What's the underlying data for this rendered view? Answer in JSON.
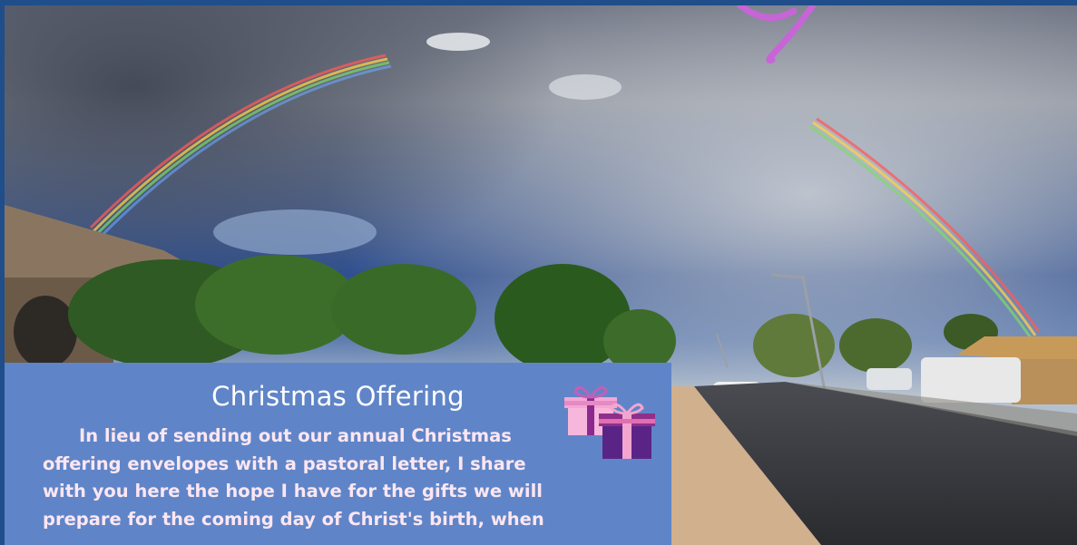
{
  "offering": {
    "title": "Christmas Offering",
    "body_lines": [
      "In lieu of sending out our annual Christmas",
      "offering envelopes with a pastoral letter, I share",
      "with you here the hope I have for the gifts we will",
      "prepare for the coming day of Christ's birth, when"
    ]
  },
  "colors": {
    "frame": "#1f4e8a",
    "panel": "#5f85c8",
    "body_text": "#fde6f1",
    "title_text": "#ffffff",
    "script_accent": "#c765d6"
  },
  "icons": {
    "gifts": "gift-boxes-icon"
  }
}
